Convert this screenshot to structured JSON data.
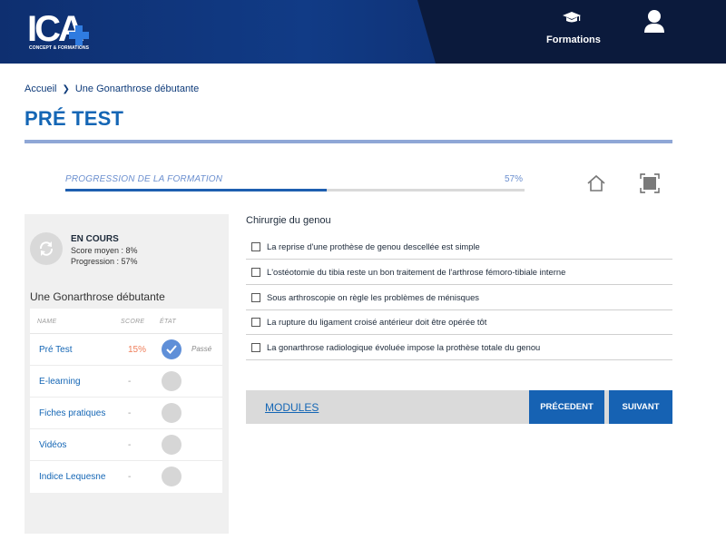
{
  "header": {
    "logo_text": "ICA",
    "logo_subtitle": "CONCEPT & FORMATIONS",
    "nav_formations_label": "Formations",
    "icons": [
      "graduation-cap-icon",
      "user-icon"
    ]
  },
  "breadcrumb": {
    "home": "Accueil",
    "current": "Une Gonarthrose débutante"
  },
  "page_title": "PRÉ TEST",
  "progress": {
    "label": "PROGRESSION DE LA FORMATION",
    "percent_text": "57%",
    "value": 0.57
  },
  "sidebar": {
    "status": {
      "title": "EN COURS",
      "score": "Score moyen : 8%",
      "progression": "Progression : 57%"
    },
    "course_title": "Une Gonarthrose débutante",
    "columns": {
      "name": "NAME",
      "score": "SCORE",
      "state": "ÉTAT"
    },
    "items": [
      {
        "name": "Pré Test",
        "score": "15%",
        "state": "Passé",
        "done": true
      },
      {
        "name": "E-learning",
        "score": "-",
        "state": "",
        "done": false
      },
      {
        "name": "Fiches pratiques",
        "score": "-",
        "state": "",
        "done": false
      },
      {
        "name": "Vidéos",
        "score": "-",
        "state": "",
        "done": false
      },
      {
        "name": "Indice Lequesne",
        "score": "-",
        "state": "",
        "done": false
      }
    ]
  },
  "question": {
    "title": "Chirurgie du genou",
    "options": [
      "La reprise d'une prothèse de genou descellée est simple",
      "L'ostéotomie du tibia reste un bon traitement de l'arthrose fémoro-tibiale interne",
      "Sous arthroscopie on règle les problèmes de ménisques",
      "La rupture du ligament croisé antérieur doit être opérée tôt",
      "La gonarthrose radiologique évoluée impose la prothèse totale du genou"
    ]
  },
  "footer": {
    "modules": "MODULES",
    "prev": "PRÉCEDENT",
    "next": "SUIVANT"
  },
  "colors": {
    "accent": "#1466b5",
    "header_dark": "#0b1a3c",
    "header_band": "#113b86",
    "progress_fill": "#1e5fb0",
    "score_highlight": "#ef7e5a"
  }
}
